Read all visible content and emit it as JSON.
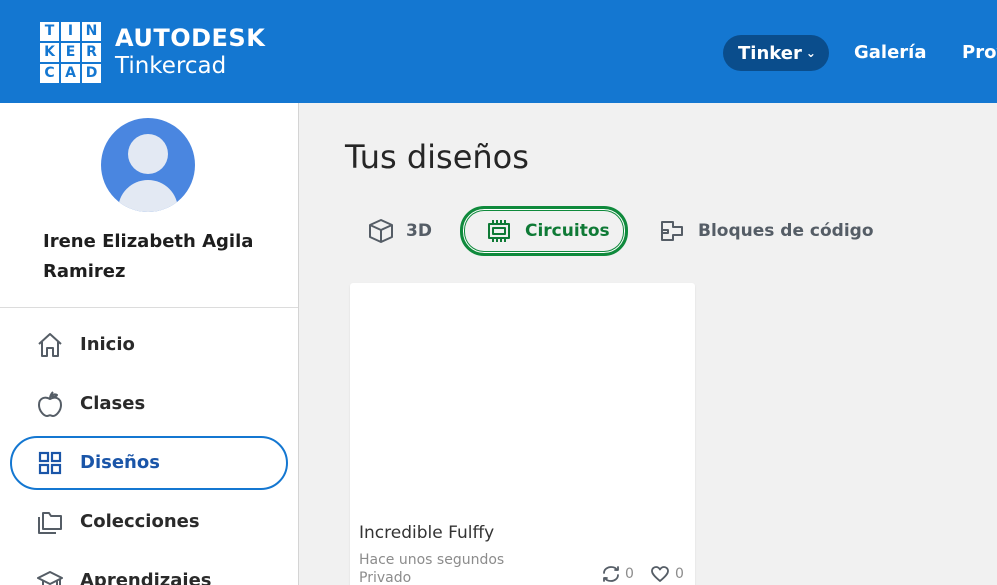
{
  "header": {
    "logo_letters": [
      "T",
      "I",
      "N",
      "K",
      "E",
      "R",
      "C",
      "A",
      "D"
    ],
    "brand_top": "AUTODESK",
    "brand_bottom": "Tinkercad",
    "nav": {
      "tinker": "Tinker",
      "galeria": "Galería",
      "proyectos": "Proy"
    }
  },
  "sidebar": {
    "user_name": "Irene Elizabeth Agila Ramirez",
    "items": [
      {
        "label": "Inicio",
        "icon": "home-icon"
      },
      {
        "label": "Clases",
        "icon": "apple-icon"
      },
      {
        "label": "Diseños",
        "icon": "grid-icon",
        "active": true
      },
      {
        "label": "Colecciones",
        "icon": "folders-icon"
      },
      {
        "label": "Aprendizajes",
        "icon": "graduation-cap-icon"
      }
    ]
  },
  "main": {
    "title": "Tus diseños",
    "tabs": [
      {
        "label": "3D",
        "icon": "cube-icon"
      },
      {
        "label": "Circuitos",
        "icon": "chip-icon",
        "active": true
      },
      {
        "label": "Bloques de código",
        "icon": "code-blocks-icon"
      }
    ],
    "designs": [
      {
        "title": "Incredible Fulffy",
        "time": "Hace unos segundos",
        "privacy": "Privado",
        "copies": "0",
        "likes": "0"
      }
    ]
  },
  "colors": {
    "header_bg": "#1477d1",
    "nav_pill_bg": "#0a4d8c",
    "active_sidebar_border": "#1477d1",
    "active_tab_green": "#0f8a3c",
    "avatar_bg": "#4a86e0"
  }
}
